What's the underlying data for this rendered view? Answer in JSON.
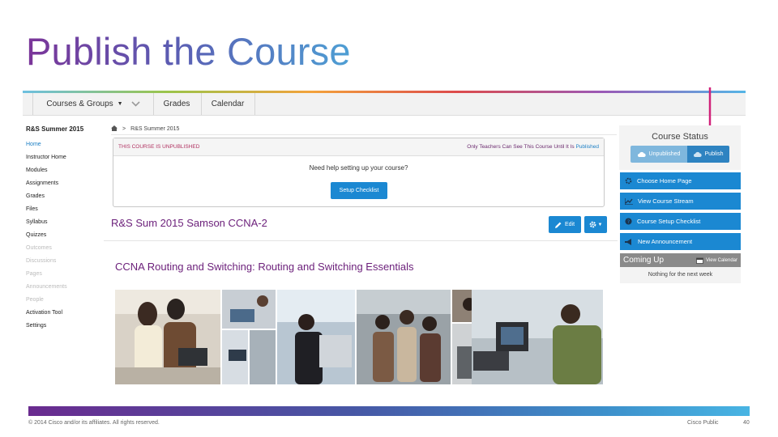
{
  "slide": {
    "title": "Publish the Course"
  },
  "topnav": {
    "courses_groups": "Courses & Groups",
    "grades": "Grades",
    "calendar": "Calendar"
  },
  "sidebar": {
    "course_name": "R&S Summer 2015",
    "items": [
      {
        "label": "Home",
        "state": "active"
      },
      {
        "label": "Instructor Home",
        "state": "normal"
      },
      {
        "label": "Modules",
        "state": "normal"
      },
      {
        "label": "Assignments",
        "state": "normal"
      },
      {
        "label": "Grades",
        "state": "normal"
      },
      {
        "label": "Files",
        "state": "normal"
      },
      {
        "label": "Syllabus",
        "state": "normal"
      },
      {
        "label": "Quizzes",
        "state": "normal"
      },
      {
        "label": "Outcomes",
        "state": "muted"
      },
      {
        "label": "Discussions",
        "state": "muted"
      },
      {
        "label": "Pages",
        "state": "muted"
      },
      {
        "label": "Announcements",
        "state": "muted"
      },
      {
        "label": "People",
        "state": "muted"
      },
      {
        "label": "Activation Tool",
        "state": "normal"
      },
      {
        "label": "Settings",
        "state": "normal"
      }
    ]
  },
  "breadcrumb": {
    "current": "R&S Summer 2015"
  },
  "notice": {
    "warning": "THIS COURSE IS UNPUBLISHED",
    "only_text": "Only Teachers Can See This Course Until It Is",
    "only_link": "Published",
    "help": "Need help setting up your course?",
    "setup_button": "Setup Checklist"
  },
  "main": {
    "course_title": "R&S Sum 2015 Samson CCNA-2",
    "edit_label": "Edit",
    "section_title": "CCNA Routing and Switching: Routing and Switching Essentials"
  },
  "status": {
    "title": "Course Status",
    "unpublished": "Unpublished",
    "publish": "Publish",
    "actions": [
      "Choose Home Page",
      "View Course Stream",
      "Course Setup Checklist",
      "New Announcement"
    ],
    "coming_up": "Coming Up",
    "view_calendar": "View Calendar",
    "nothing": "Nothing for the next week"
  },
  "footer": {
    "copyright": "© 2014 Cisco and/or its affiliates. All rights reserved.",
    "classification": "Cisco Public",
    "page": "40"
  },
  "colors": {
    "accent_blue": "#1b88d2",
    "title_purple": "#6b1f7a",
    "arrow_pink": "#d0227a"
  }
}
